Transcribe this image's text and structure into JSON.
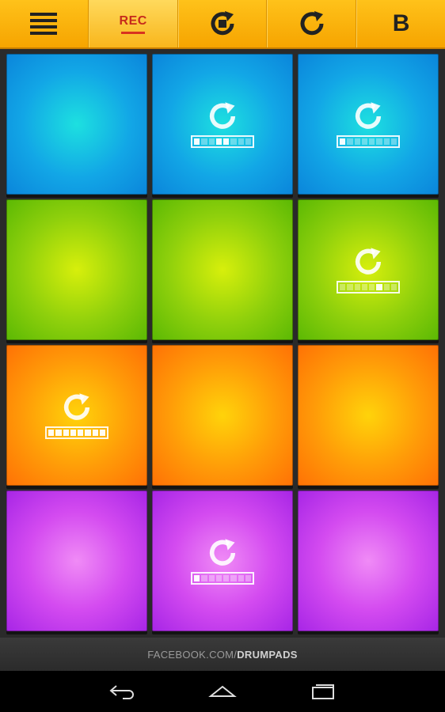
{
  "toolbar": {
    "menu_icon": "menu-icon",
    "rec_label": "REC",
    "rec_accent": "#d8321f",
    "stop_loop_icon": "loop-stop-icon",
    "redo_icon": "redo-icon",
    "bank_label": "B"
  },
  "pads": [
    {
      "color": "blue",
      "loop": false
    },
    {
      "color": "blue",
      "loop": true,
      "segments": [
        1,
        0,
        0,
        1,
        1,
        0,
        0,
        0
      ]
    },
    {
      "color": "blue",
      "loop": true,
      "segments": [
        1,
        0,
        0,
        0,
        0,
        0,
        0,
        0
      ]
    },
    {
      "color": "green",
      "loop": false
    },
    {
      "color": "green",
      "loop": false
    },
    {
      "color": "green",
      "loop": true,
      "segments": [
        0,
        0,
        0,
        0,
        0,
        1,
        0,
        0
      ]
    },
    {
      "color": "orange",
      "loop": true,
      "segments": [
        1,
        1,
        1,
        1,
        1,
        1,
        1,
        1
      ]
    },
    {
      "color": "orange",
      "loop": false
    },
    {
      "color": "orange",
      "loop": false
    },
    {
      "color": "purple",
      "loop": false
    },
    {
      "color": "purple",
      "loop": true,
      "segments": [
        1,
        0,
        0,
        0,
        0,
        0,
        0,
        0
      ]
    },
    {
      "color": "purple",
      "loop": false
    }
  ],
  "footer": {
    "prefix": "FACEBOOK.COM/",
    "brand": "DRUMPADS"
  },
  "nav": {
    "back_icon": "back-icon",
    "home_icon": "home-icon",
    "recents_icon": "recents-icon"
  }
}
